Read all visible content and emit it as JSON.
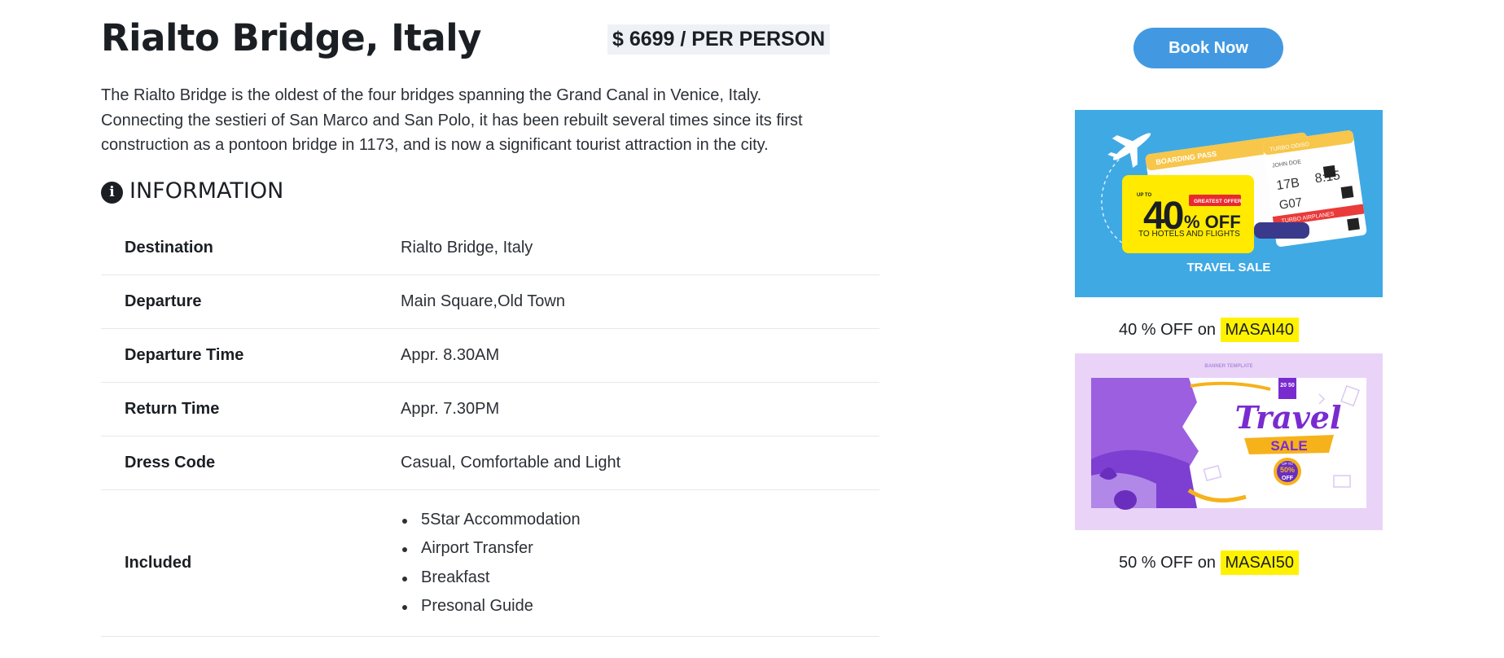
{
  "tour": {
    "title": "Rialto Bridge, Italy",
    "price": "$ 6699 / PER PERSON",
    "description": "The Rialto Bridge is the oldest of the four bridges spanning the Grand Canal in Venice, Italy. Connecting the sestieri of San Marco and San Polo, it has been rebuilt several times since its first construction as a pontoon bridge in 1173, and is now a significant tourist attraction in the city."
  },
  "information": {
    "heading": "INFORMATION",
    "icon": "info-icon",
    "rows": [
      {
        "label": "Destination",
        "value": "Rialto Bridge, Italy"
      },
      {
        "label": "Departure",
        "value": "Main Square,Old Town"
      },
      {
        "label": "Departure Time",
        "value": "Appr. 8.30AM"
      },
      {
        "label": "Return Time",
        "value": "Appr. 7.30PM"
      },
      {
        "label": "Dress Code",
        "value": "Casual, Comfortable and Light"
      }
    ],
    "included": {
      "label": "Included",
      "items": [
        "5Star Accommodation",
        "Airport Transfer",
        "Breakfast",
        "Presonal Guide"
      ]
    }
  },
  "sidebar": {
    "book_label": "Book Now",
    "promo1": {
      "up_to": "UP TO",
      "discount_number": "40",
      "discount_suffix": "% OFF",
      "greatest_offer": "GREATEST OFFER",
      "subtitle": "TO HOTELS AND FLIGHTS",
      "sale_title": "TRAVEL SALE",
      "pass_header": "BOARDING PASS",
      "pass_line": "TURBO ODISO",
      "pass_name": "JOHN DOE",
      "seat": "17B",
      "time": "8:15",
      "gate": "G07",
      "airline": "TURBO AIRPLANES"
    },
    "coupon1": {
      "text": "40 % OFF on ",
      "code": "MASAI40"
    },
    "promo2": {
      "banner_label": "BANNER TEMPLATE",
      "year": "20 50",
      "title": "Travel",
      "sale": "SALE",
      "badge_top": "UP TO",
      "badge_pct": "50%",
      "badge_off": "OFF"
    },
    "coupon2": {
      "text": "50 % OFF on ",
      "code": "MASAI50"
    }
  },
  "colors": {
    "accent": "#4299e1",
    "highlight": "#fff200",
    "promo1_bg": "#3fa9e4",
    "promo2_bg": "#e9d4f8"
  }
}
